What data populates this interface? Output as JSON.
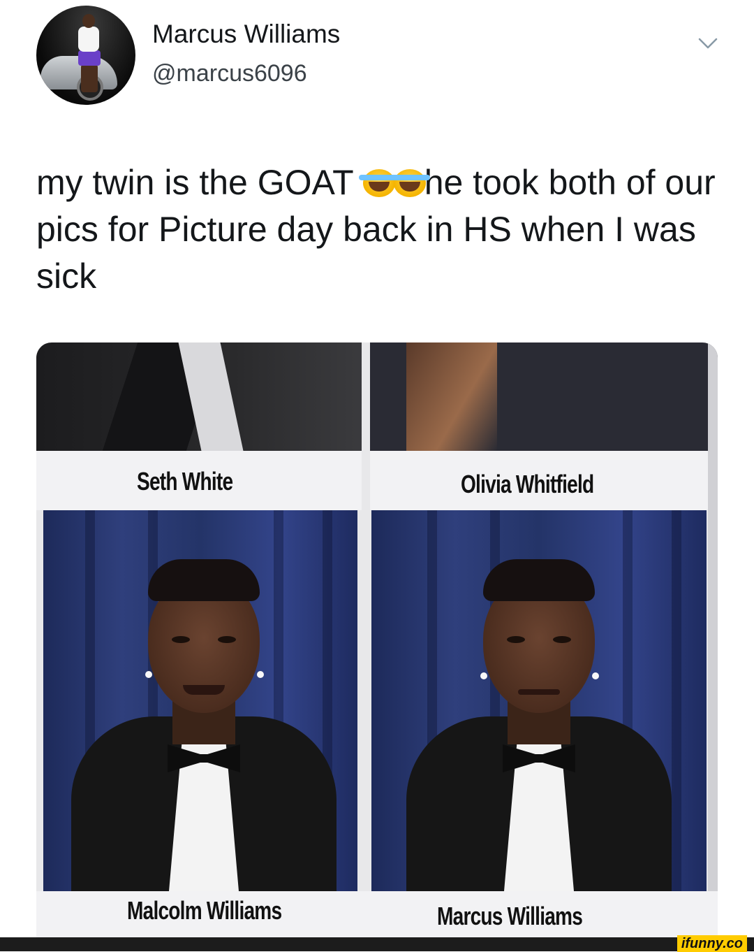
{
  "tweet": {
    "author_name": "Marcus Williams",
    "author_handle": "@marcus6096",
    "text_part1": "my twin is the GOAT ",
    "emoji_name": "face-with-tears-of-joy",
    "text_part2": "he took both of our pics for Picture day back in HS when I was sick"
  },
  "yearbook": {
    "top_labels": [
      "Seth White",
      "Olivia Whitfield"
    ],
    "bottom_labels": [
      "Malcolm Williams",
      "Marcus Williams"
    ]
  },
  "watermark": {
    "text": "ifunny.co"
  },
  "icons": {
    "chevron": "chevron-down-icon",
    "avatar": "avatar"
  },
  "colors": {
    "text": "#14171a",
    "handle": "#3b4248",
    "curtain": "#2f3f7c",
    "watermark_bg": "#ffcc00"
  }
}
